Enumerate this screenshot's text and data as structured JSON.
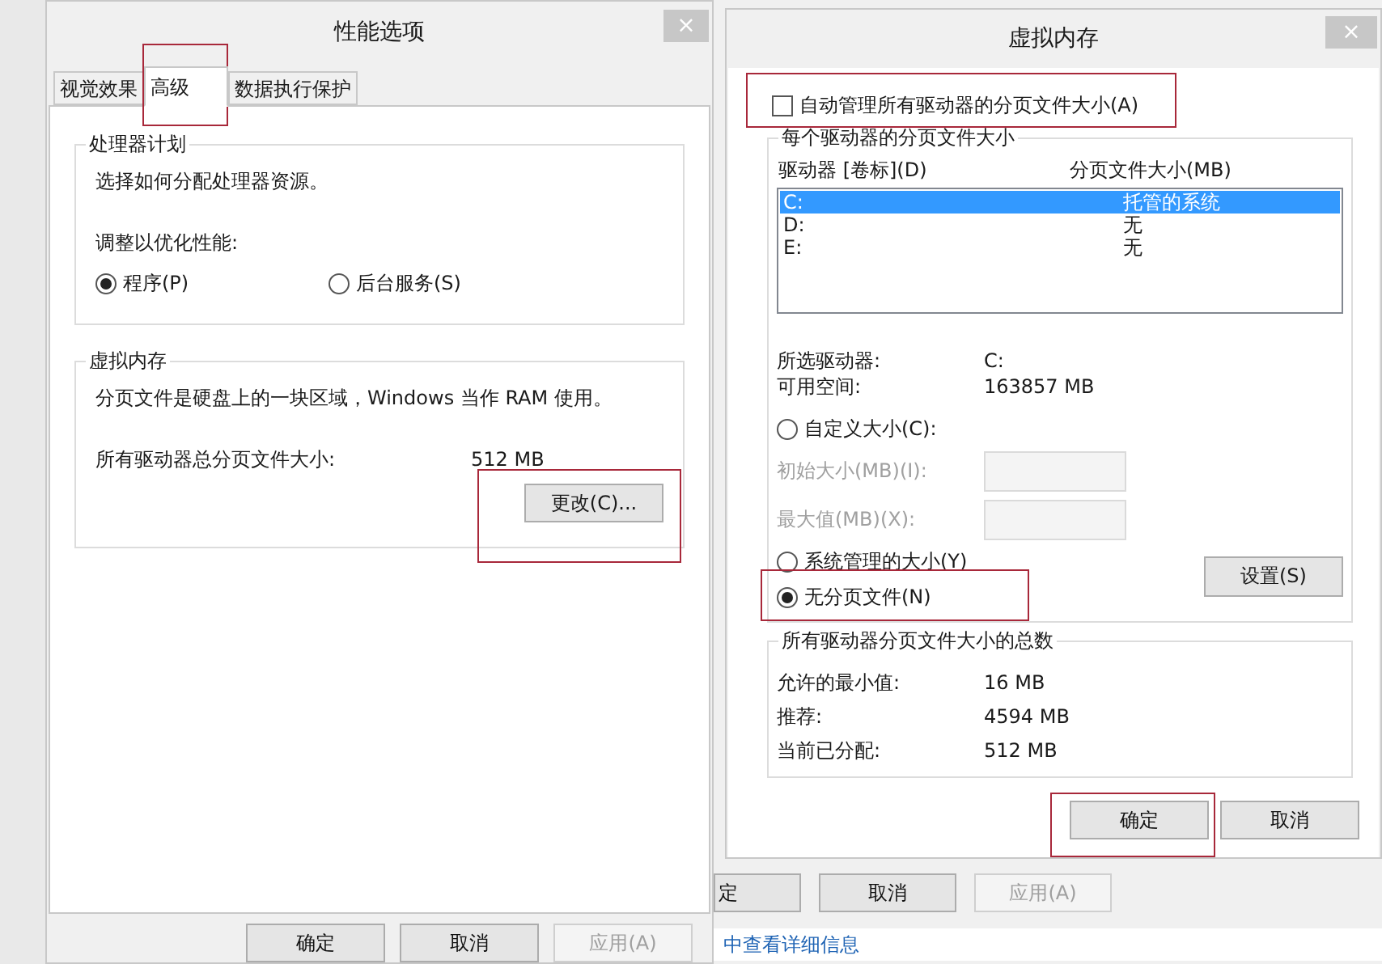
{
  "performance_options": {
    "title": "性能选项",
    "close": "×",
    "tabs": [
      {
        "label": "视觉效果",
        "selected": false
      },
      {
        "label": "高级",
        "selected": true
      },
      {
        "label": "数据执行保护",
        "selected": false
      }
    ],
    "processor_group": {
      "title": "处理器计划",
      "description": "选择如何分配处理器资源。",
      "adjust_label": "调整以优化性能:",
      "options": [
        {
          "label": "程序(P)",
          "selected": true
        },
        {
          "label": "后台服务(S)",
          "selected": false
        }
      ]
    },
    "virtual_memory_group": {
      "title": "虚拟内存",
      "description": "分页文件是硬盘上的一块区域，Windows 当作 RAM 使用。",
      "total_label": "所有驱动器总分页文件大小:",
      "total_value": "512 MB",
      "change_button": "更改(C)..."
    },
    "buttons": [
      {
        "label": "确定",
        "disabled": false
      },
      {
        "label": "取消",
        "disabled": false
      },
      {
        "label": "应用(A)",
        "disabled": true
      }
    ]
  },
  "background_window": {
    "buttons": [
      {
        "label": "定",
        "disabled": false
      },
      {
        "label": "取消",
        "disabled": false
      },
      {
        "label": "应用(A)",
        "disabled": true
      }
    ],
    "link": "中查看详细信息"
  },
  "virtual_memory": {
    "title": "虚拟内存",
    "close": "×",
    "auto_manage": {
      "label": "自动管理所有驱动器的分页文件大小(A)",
      "checked": false
    },
    "per_drive_group": {
      "title": "每个驱动器的分页文件大小",
      "columns": [
        "驱动器 [卷标](D)",
        "分页文件大小(MB)"
      ],
      "drives": [
        {
          "drive": "C:",
          "size": "托管的系统",
          "selected": true
        },
        {
          "drive": "D:",
          "size": "无",
          "selected": false
        },
        {
          "drive": "E:",
          "size": "无",
          "selected": false
        }
      ],
      "info": [
        {
          "label": "所选驱动器:",
          "value": "C:"
        },
        {
          "label": "可用空间:",
          "value": "163857 MB"
        }
      ],
      "size_settings": [
        {
          "kind": "radio",
          "label": "自定义大小(C):",
          "selected": false
        },
        {
          "kind": "field",
          "label": "初始大小(MB)(I):",
          "disabled": true
        },
        {
          "kind": "field",
          "label": "最大值(MB)(X):",
          "disabled": true
        },
        {
          "kind": "radio",
          "label": "系统管理的大小(Y)",
          "selected": false
        },
        {
          "kind": "radio",
          "label": "无分页文件(N)",
          "selected": true
        }
      ],
      "set_button": "设置(S)"
    },
    "totals_group": {
      "title": "所有驱动器分页文件大小的总数",
      "rows": [
        {
          "label": "允许的最小值:",
          "value": "16 MB"
        },
        {
          "label": "推荐:",
          "value": "4594 MB"
        },
        {
          "label": "当前已分配:",
          "value": "512 MB"
        }
      ]
    },
    "buttons": [
      {
        "label": "确定",
        "disabled": false
      },
      {
        "label": "取消",
        "disabled": false
      }
    ]
  }
}
